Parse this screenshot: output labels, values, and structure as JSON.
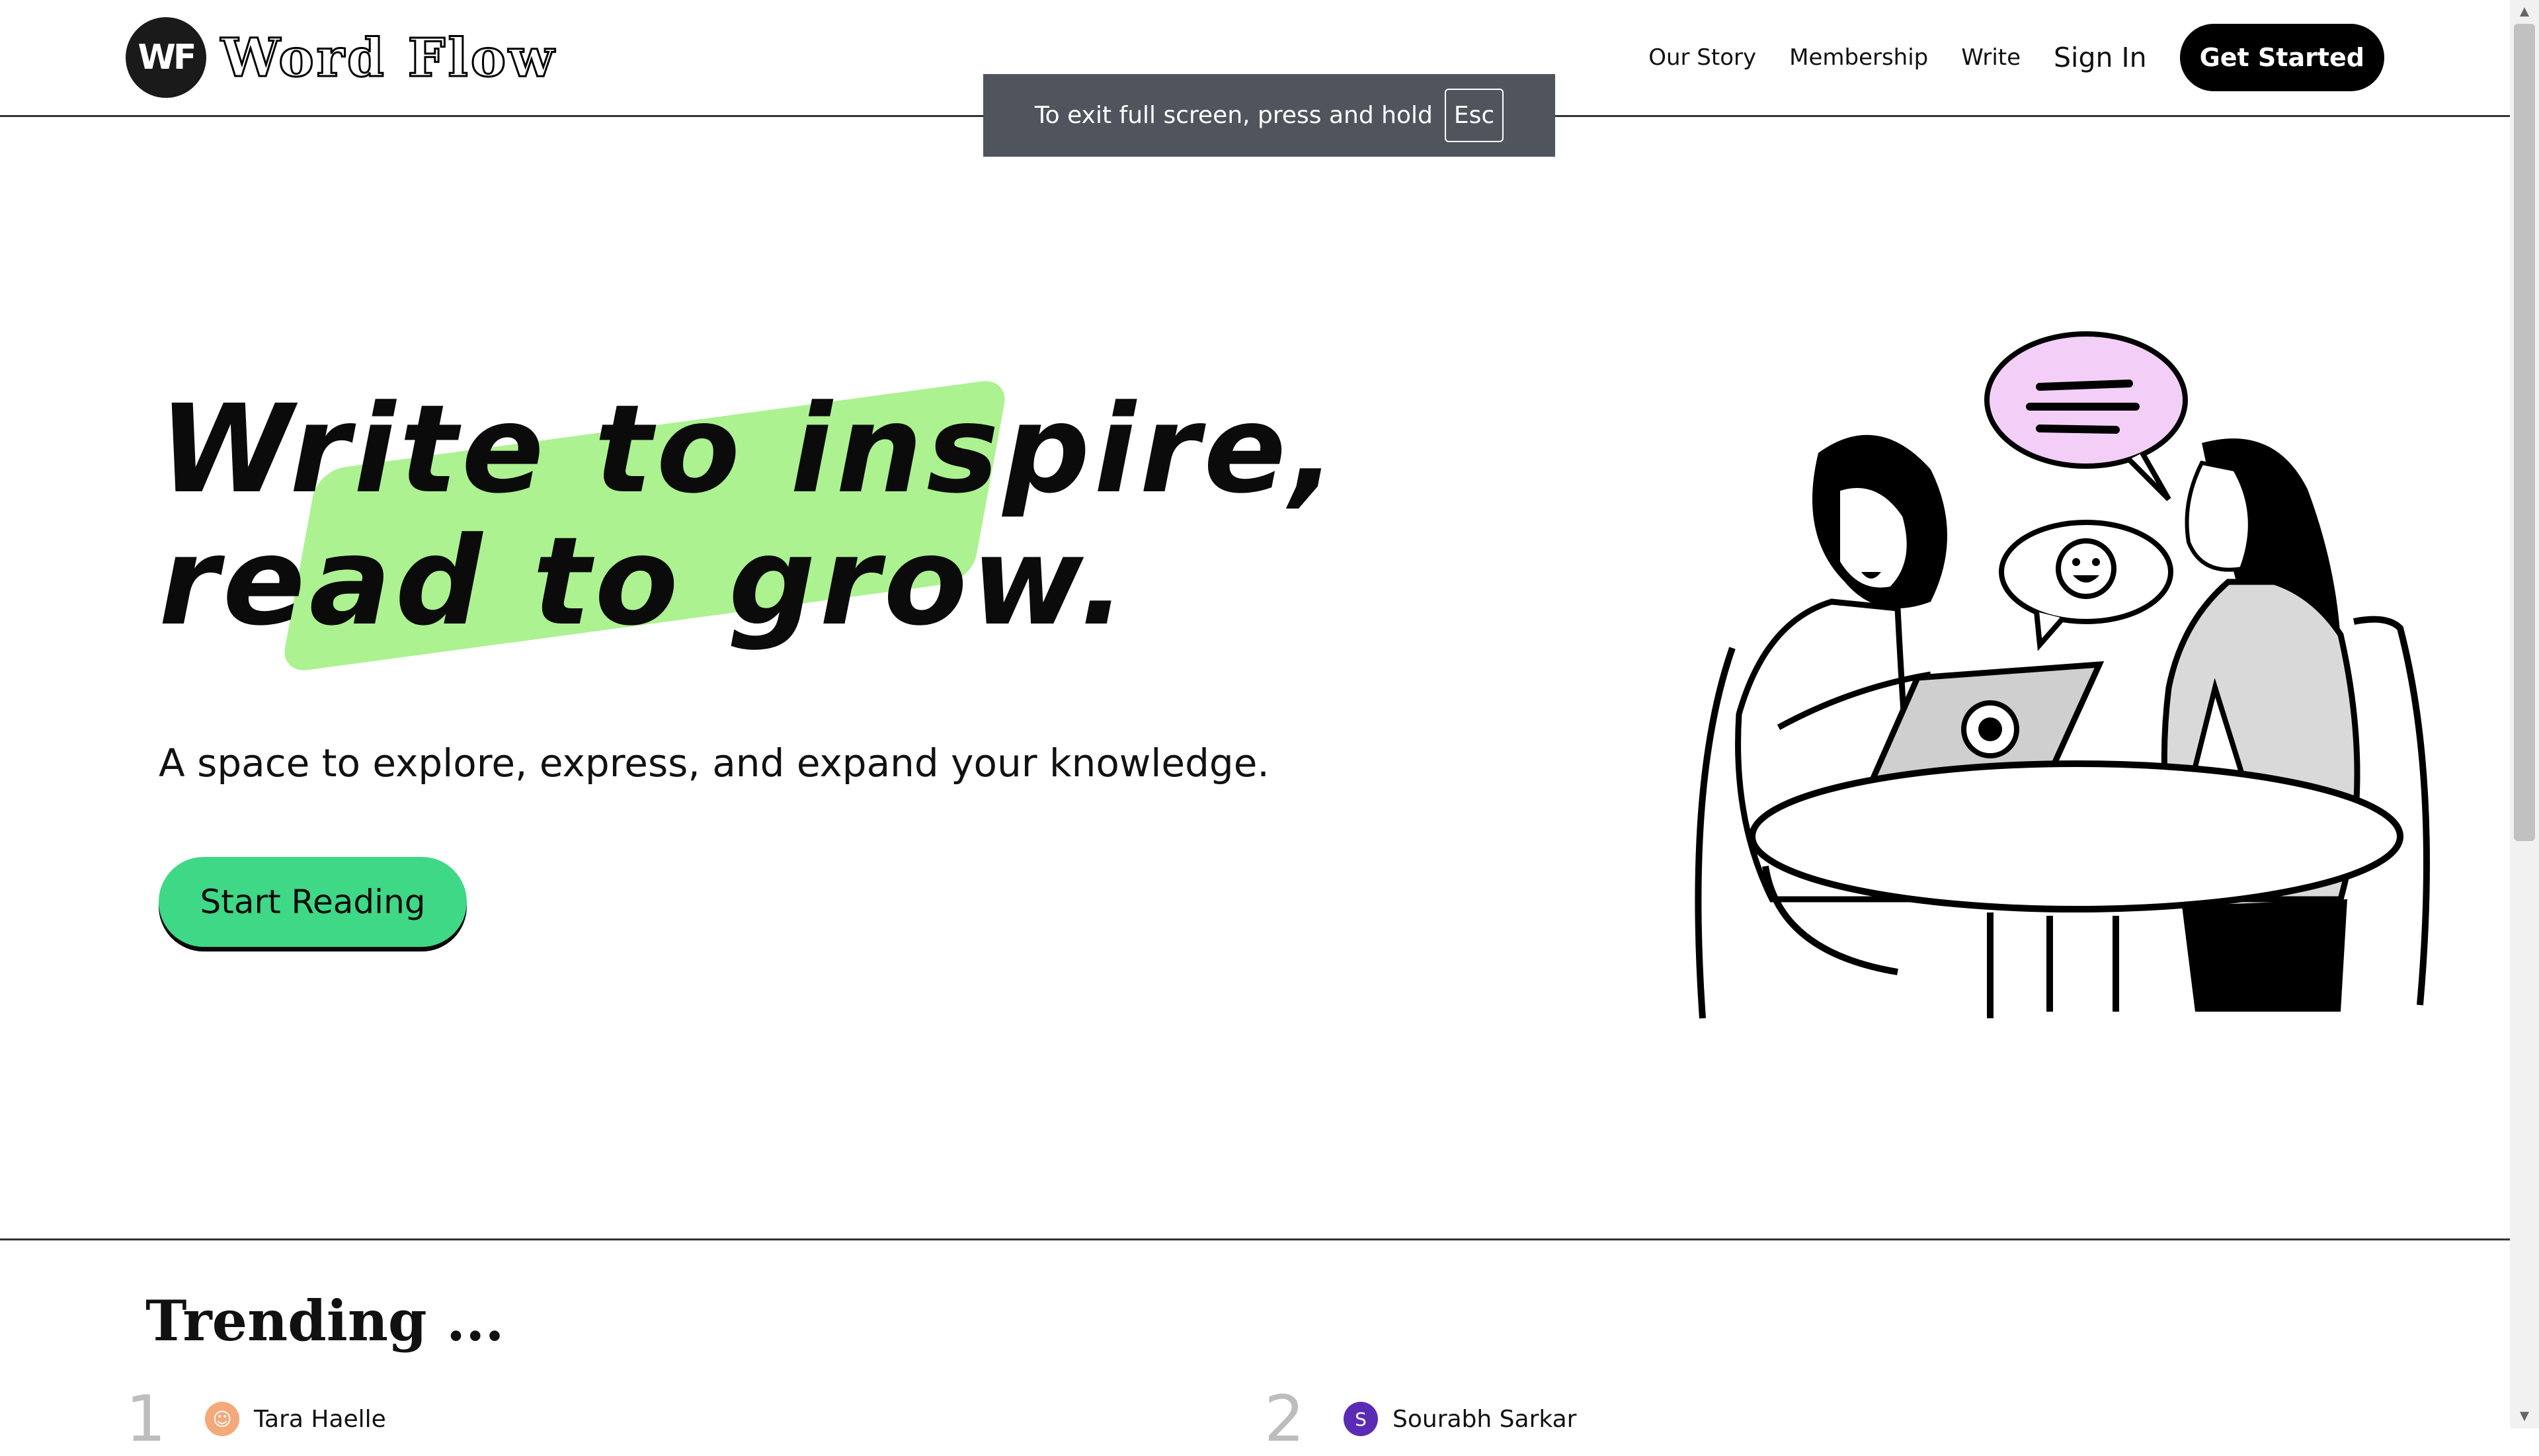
{
  "brand": {
    "logo_mark": "WF",
    "name": "Word Flow"
  },
  "nav": {
    "items": [
      "Our Story",
      "Membership",
      "Write"
    ],
    "sign_in": "Sign In",
    "get_started": "Get Started"
  },
  "fullscreen_toast": {
    "text": "To exit full screen, press and hold",
    "key": "Esc"
  },
  "hero": {
    "title_line1": "Write to inspire,",
    "title_line2": "read to grow.",
    "subtitle": "A space to explore, express, and expand your knowledge.",
    "cta": "Start Reading",
    "highlight_color": "#9df07c",
    "cta_color": "#3ed887"
  },
  "trending": {
    "title": "Trending ...",
    "items": [
      {
        "rank": "1",
        "author": "Tara Haelle",
        "avatar": "tara-avatar-icon"
      },
      {
        "rank": "2",
        "author": "Sourabh Sarkar",
        "avatar_initial": "S"
      }
    ]
  },
  "icons": {
    "illustration": "two-people-chatting-illustration",
    "scroll_up": "chevron-up-icon",
    "scroll_down": "chevron-down-icon"
  }
}
